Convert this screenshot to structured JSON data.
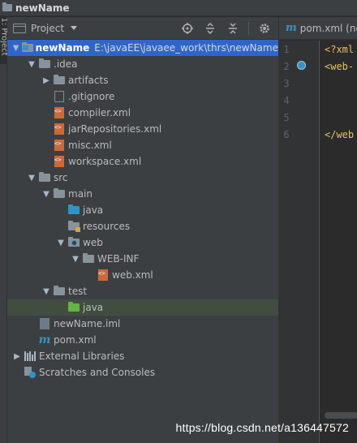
{
  "window": {
    "title": "newName"
  },
  "side_strip": {
    "tab_label": "1: Project"
  },
  "project_panel": {
    "view_label": "Project",
    "tools": [
      "locate-icon",
      "expand-all-icon",
      "collapse-all-icon",
      "gear-icon"
    ]
  },
  "tree": [
    {
      "name": "newName",
      "path": "E:\\javaEE\\javaee_work\\thrs\\newName",
      "depth": 0,
      "arrow": "▼",
      "icon": "module-folder-icon",
      "selected": true
    },
    {
      "name": ".idea",
      "depth": 1,
      "arrow": "▼",
      "icon": "folder-icon"
    },
    {
      "name": "artifacts",
      "depth": 2,
      "arrow": "▶",
      "icon": "folder-icon"
    },
    {
      "name": ".gitignore",
      "depth": 2,
      "arrow": "",
      "icon": "gitignore-file-icon"
    },
    {
      "name": "compiler.xml",
      "depth": 2,
      "arrow": "",
      "icon": "xml-file-icon"
    },
    {
      "name": "jarRepositories.xml",
      "depth": 2,
      "arrow": "",
      "icon": "xml-file-icon"
    },
    {
      "name": "misc.xml",
      "depth": 2,
      "arrow": "",
      "icon": "xml-file-icon"
    },
    {
      "name": "workspace.xml",
      "depth": 2,
      "arrow": "",
      "icon": "xml-file-icon"
    },
    {
      "name": "src",
      "depth": 1,
      "arrow": "▼",
      "icon": "folder-icon"
    },
    {
      "name": "main",
      "depth": 2,
      "arrow": "▼",
      "icon": "folder-icon"
    },
    {
      "name": "java",
      "depth": 3,
      "arrow": "",
      "icon": "source-folder-icon"
    },
    {
      "name": "resources",
      "depth": 3,
      "arrow": "",
      "icon": "resources-folder-icon"
    },
    {
      "name": "web",
      "depth": 3,
      "arrow": "▼",
      "icon": "web-folder-icon"
    },
    {
      "name": "WEB-INF",
      "depth": 4,
      "arrow": "▼",
      "icon": "folder-icon"
    },
    {
      "name": "web.xml",
      "depth": 5,
      "arrow": "",
      "icon": "web-xml-file-icon"
    },
    {
      "name": "test",
      "depth": 2,
      "arrow": "▼",
      "icon": "folder-icon"
    },
    {
      "name": "java",
      "depth": 3,
      "arrow": "",
      "icon": "test-source-folder-icon",
      "hovered": true
    },
    {
      "name": "newName.iml",
      "depth": 1,
      "arrow": "",
      "icon": "iml-file-icon"
    },
    {
      "name": "pom.xml",
      "depth": 1,
      "arrow": "",
      "icon": "maven-icon"
    },
    {
      "name": "External Libraries",
      "depth": 0,
      "arrow": "▶",
      "icon": "libraries-icon"
    },
    {
      "name": "Scratches and Consoles",
      "depth": 0,
      "arrow": "",
      "icon": "scratches-icon"
    }
  ],
  "editor": {
    "tab_label": "pom.xml (ne",
    "lines": [
      {
        "num": "1",
        "code": "<?xml"
      },
      {
        "num": "2",
        "code": "<web-"
      },
      {
        "num": "3",
        "code": ""
      },
      {
        "num": "4",
        "code": ""
      },
      {
        "num": "5",
        "code": ""
      },
      {
        "num": "6",
        "code": "</web"
      }
    ]
  },
  "watermark": "https://blog.csdn.net/a136447572"
}
